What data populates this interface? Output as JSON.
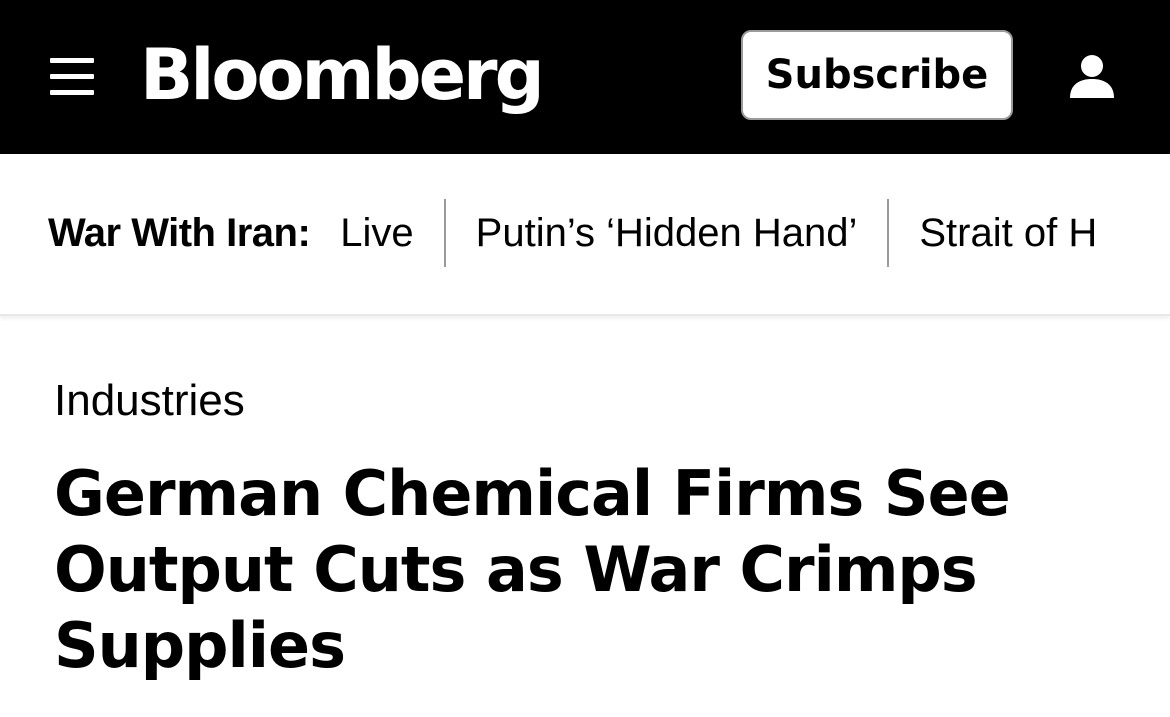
{
  "header": {
    "logo_text": "Bloomberg",
    "subscribe_label": "Subscribe",
    "menu_icon": "hamburger-menu-icon",
    "account_icon": "user-account-icon",
    "background": "#000000"
  },
  "nav": {
    "label": "War With Iran:",
    "links": [
      {
        "label": "Live"
      },
      {
        "label": "Putin’s ‘Hidden Hand’"
      },
      {
        "label": "Strait of H"
      }
    ]
  },
  "article": {
    "section": "Industries",
    "headline": "German Chemical Firms See Output Cuts as War Crimps Supplies"
  }
}
